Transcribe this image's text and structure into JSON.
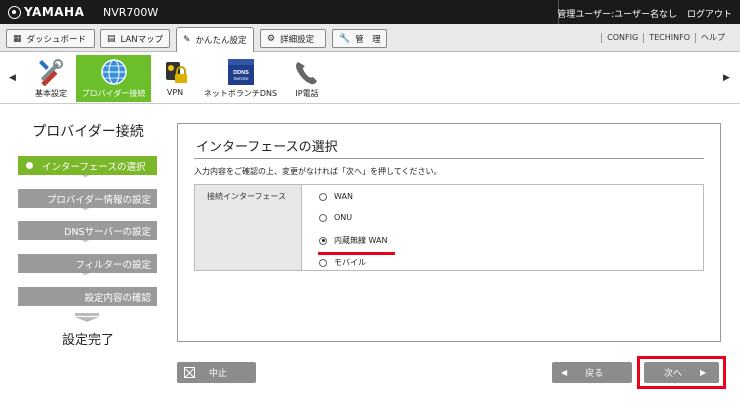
{
  "header": {
    "brand": "YAMAHA",
    "model": "NVR700W",
    "user": "管理ユーザー:ユーザー名なし",
    "logout": "ログアウト"
  },
  "tabs": [
    {
      "label": "ダッシュボード",
      "icon": "grid-icon"
    },
    {
      "label": "LANマップ",
      "icon": "lan-map-icon"
    },
    {
      "label": "かんたん設定",
      "icon": "wizard-icon",
      "active": true
    },
    {
      "label": "詳細設定",
      "icon": "gear-icon"
    },
    {
      "label": "管　理",
      "icon": "wrench-icon"
    }
  ],
  "top_links": [
    "CONFIG",
    "TECHINFO",
    "ヘルプ"
  ],
  "toolbar": {
    "items": [
      {
        "label": "基本設定",
        "icon": "tools-icon"
      },
      {
        "label": "プロバイダー接続",
        "icon": "globe-icon",
        "active": true
      },
      {
        "label": "VPN",
        "icon": "vpn-lock-icon"
      },
      {
        "label": "ネットボランチDNS",
        "icon": "ddns-service-icon",
        "icon_text": "DDNS Service"
      },
      {
        "label": "IP電話",
        "icon": "phone-icon"
      }
    ]
  },
  "wizard": {
    "title": "プロバイダー接続",
    "steps": [
      {
        "label": "インターフェースの選択",
        "current": true
      },
      {
        "label": "プロバイダー情報の設定"
      },
      {
        "label": "DNSサーバーの設定"
      },
      {
        "label": "フィルターの設定"
      },
      {
        "label": "設定内容の確認"
      }
    ],
    "done": "設定完了"
  },
  "panel": {
    "title": "インターフェースの選択",
    "description": "入力内容をご確認の上、変更がなければ「次へ」を押してください。",
    "field_label": "接続インターフェース",
    "options": [
      {
        "label": "WAN",
        "selected": false
      },
      {
        "label": "ONU",
        "selected": false
      },
      {
        "label": "内蔵無線 WAN",
        "selected": true
      },
      {
        "label": "モバイル",
        "selected": false
      }
    ]
  },
  "buttons": {
    "cancel": "中止",
    "back": "戻る",
    "next": "次へ"
  },
  "colors": {
    "accent_green": "#7ab829",
    "highlight_red": "#e8001c",
    "button_gray": "#8c8c8c"
  }
}
